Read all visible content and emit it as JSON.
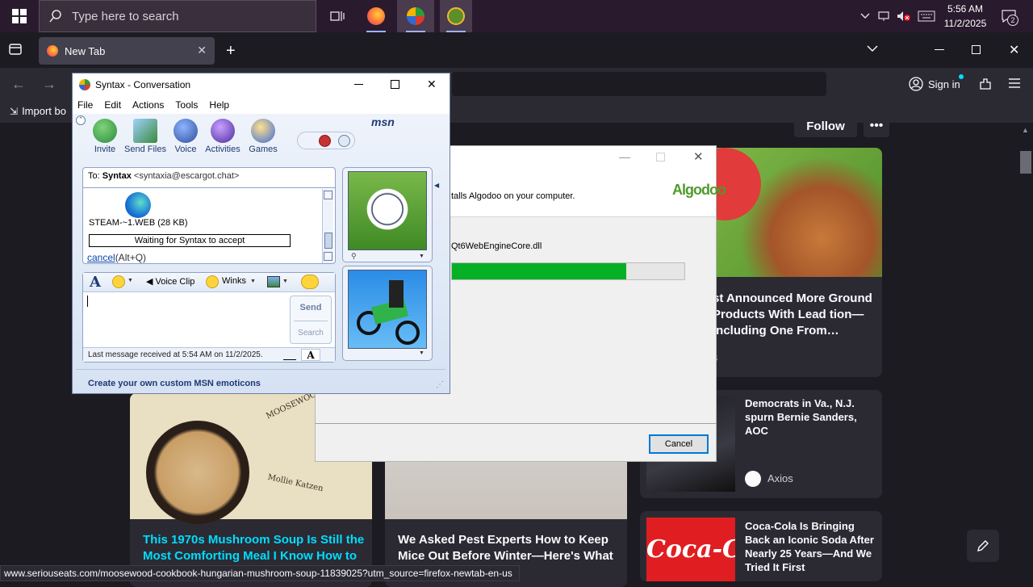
{
  "taskbar": {
    "search_placeholder": "Type here to search",
    "time": "5:56 AM",
    "date": "11/2/2025",
    "notification_count": "2"
  },
  "firefox": {
    "tab_title": "New Tab",
    "import_bookmarks": "Import bo",
    "sign_in": "Sign in",
    "follow": "Follow",
    "status_url": "www.seriouseats.com/moosewood-cookbook-hungarian-mushroom-soup-11839025?utm_source=firefox-newtab-en-us"
  },
  "news": {
    "cards": [
      {
        "title": "This 1970s Mushroom Soup Is Still the Most Comforting Meal I Know How to",
        "image_text_1": "MOOSEWOOD",
        "image_text_2": "Mollie Katzen"
      },
      {
        "title": "We Asked Pest Experts How to Keep Mice Out Before Winter—Here's What"
      },
      {
        "title": "st Announced More Ground Products With Lead tion—Including One From…",
        "source": "s"
      },
      {
        "title": "Democrats in Va., N.J. spurn Bernie Sanders, AOC",
        "source": "Axios"
      },
      {
        "title": "Coca-Cola Is Bringing Back an Iconic Soda After Nearly 25 Years—And We Tried It First",
        "image_text": "Coca-Cola"
      }
    ]
  },
  "installer": {
    "description": "talls Algodoo on your computer.",
    "logo": "Algodoo",
    "file": "Qt6WebEngineCore.dll",
    "progress": 0.75,
    "cancel_label": "Cancel"
  },
  "msn": {
    "title": "Syntax - Conversation",
    "menu": [
      "File",
      "Edit",
      "Actions",
      "Tools",
      "Help"
    ],
    "logo": "msn",
    "toolbar": [
      "Invite",
      "Send Files",
      "Voice",
      "Activities",
      "Games"
    ],
    "to_label": "To:",
    "contact_name": "Syntax",
    "contact_email": "<syntaxia@escargot.chat>",
    "file_name": "STEAM-~1.WEB (28 KB)",
    "waiting_text": "Waiting for Syntax to accept",
    "cancel_link": "cancel",
    "cancel_shortcut": "(Alt+Q)",
    "voice_clip": "Voice Clip",
    "winks": "Winks",
    "send": "Send",
    "search": "Search",
    "last_message": "Last message received at 5:54 AM on 11/2/2025.",
    "footer": "Create your own custom MSN emoticons"
  },
  "colors": {
    "progress_fill": "#06b025",
    "link": "#0645ad",
    "card_title_link": "#00ddff"
  }
}
